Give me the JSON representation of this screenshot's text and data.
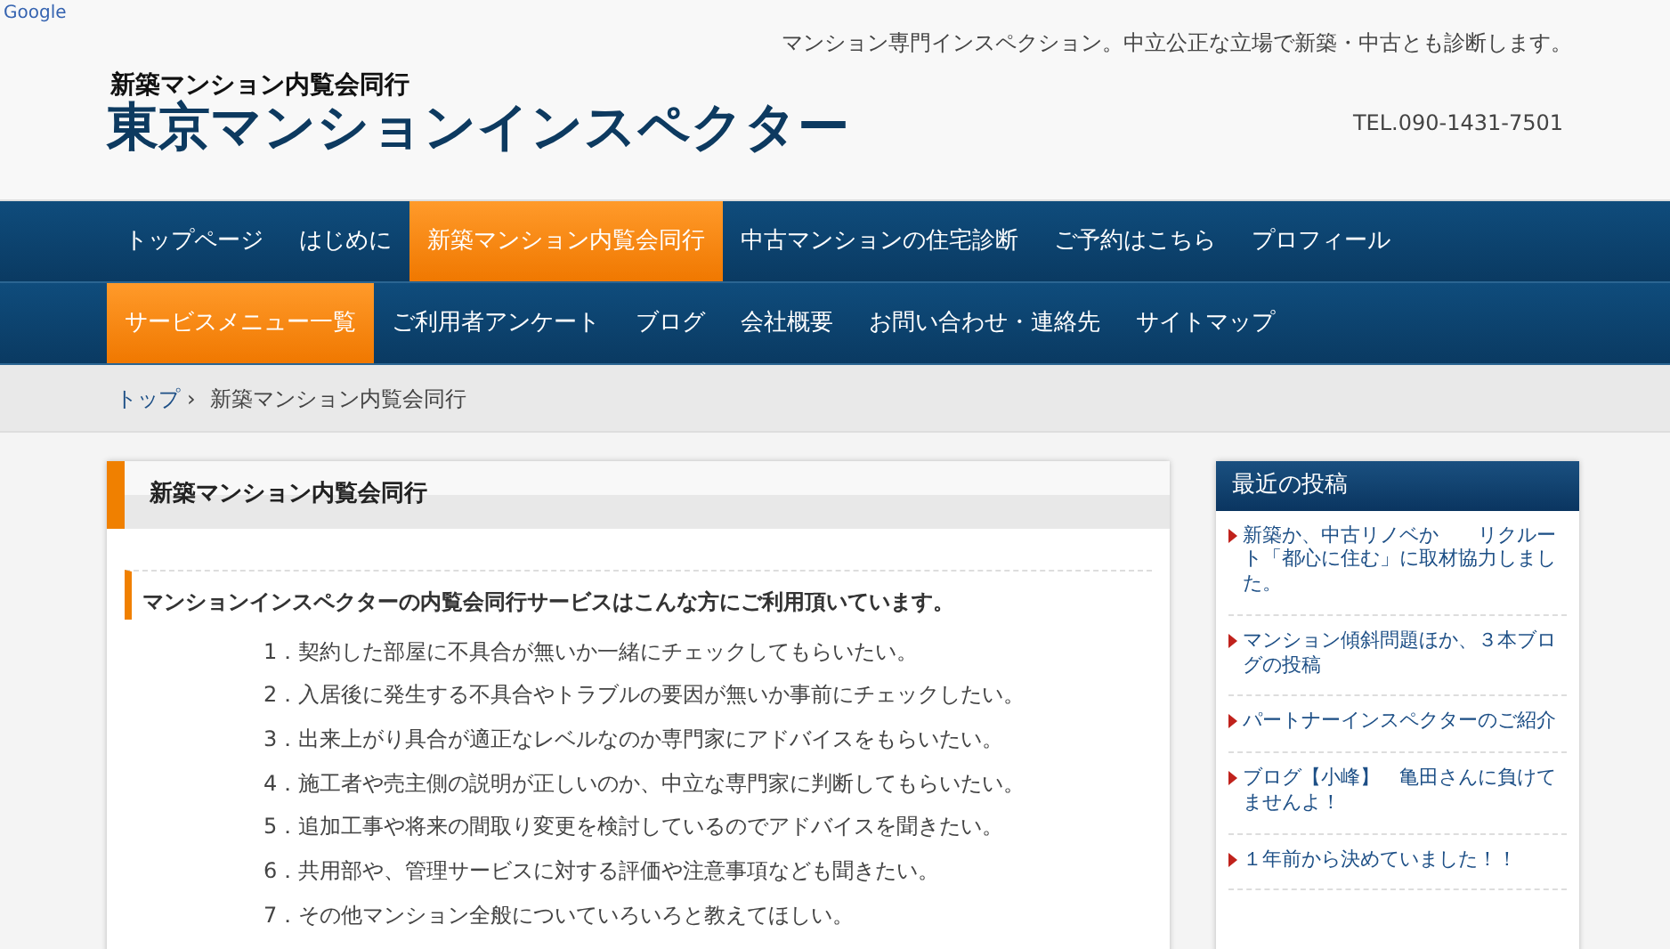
{
  "google_label": "Google",
  "header": {
    "tagline": "マンション専門インスペクション。中立公正な立場で新築・中古とも診断します。",
    "subtitle": "新築マンション内覧会同行",
    "site_title": "東京マンションインスペクター",
    "phone": "TEL.090-1431-7501"
  },
  "nav_primary": [
    {
      "label": "トップページ",
      "selected": false
    },
    {
      "label": "はじめに",
      "selected": false
    },
    {
      "label": "新築マンション内覧会同行",
      "selected": true
    },
    {
      "label": "中古マンションの住宅診断",
      "selected": false
    },
    {
      "label": "ご予約はこちら",
      "selected": false
    },
    {
      "label": "プロフィール",
      "selected": false
    }
  ],
  "nav_secondary": [
    {
      "label": "サービスメニュー一覧",
      "selected": true
    },
    {
      "label": "ご利用者アンケート",
      "selected": false
    },
    {
      "label": "ブログ",
      "selected": false
    },
    {
      "label": "会社概要",
      "selected": false
    },
    {
      "label": "お問い合わせ・連絡先",
      "selected": false
    },
    {
      "label": "サイトマップ",
      "selected": false
    }
  ],
  "breadcrumb_separator": "›",
  "breadcrumb": [
    {
      "label": "トップ",
      "link": true
    },
    {
      "label": "新築マンション内覧会同行",
      "link": false
    }
  ],
  "main": {
    "title": "新築マンション内覧会同行",
    "section_heading": "マンションインスペクターの内覧会同行サービスはこんな方にご利用頂いています。",
    "items": [
      "1．契約した部屋に不具合が無いか一緒にチェックしてもらいたい。",
      "2．入居後に発生する不具合やトラブルの要因が無いか事前にチェックしたい。",
      "3．出来上がり具合が適正なレベルなのか専門家にアドバイスをもらいたい。",
      "4．施工者や売主側の説明が正しいのか、中立な専門家に判断してもらいたい。",
      "5．追加工事や将来の間取り変更を検討しているのでアドバイスを聞きたい。",
      "6．共用部や、管理サービスに対する評価や注意事項なども聞きたい。",
      "7．その他マンション全般についていろいろと教えてほしい。"
    ]
  },
  "sidebar": {
    "title": "最近の投稿",
    "posts": [
      "新築か、中古リノベか　　リクルート「都心に住む」に取材協力しました。",
      "マンション傾斜問題ほか、３本ブログの投稿",
      "パートナーインスペクターのご紹介",
      "ブログ【小峰】　亀田さんに負けてませんよ！",
      "１年前から決めていました！！"
    ]
  }
}
